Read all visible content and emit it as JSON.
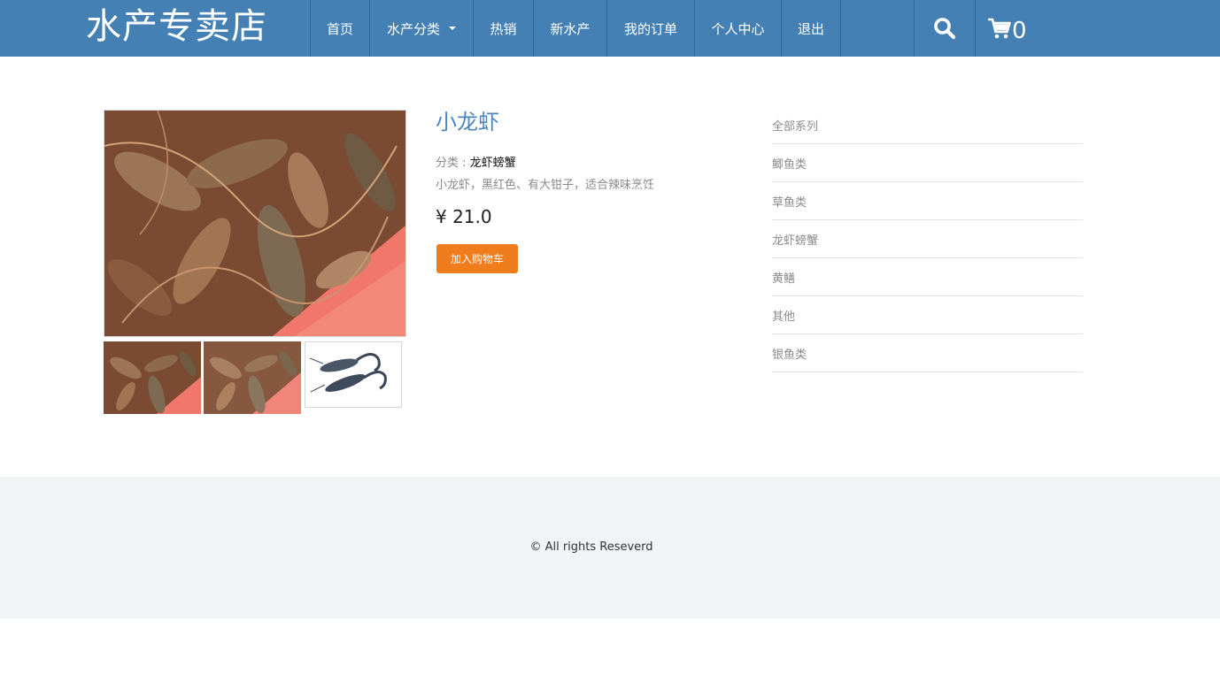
{
  "brand": {
    "name": "水产专卖店"
  },
  "nav": {
    "items": [
      {
        "label": "首页"
      },
      {
        "label": "水产分类"
      },
      {
        "label": "热销"
      },
      {
        "label": "新水产"
      },
      {
        "label": "我的订单"
      },
      {
        "label": "个人中心"
      },
      {
        "label": "退出"
      }
    ],
    "search_icon": "search-icon",
    "cart_icon": "shopping-cart-icon",
    "cart_count": "0"
  },
  "product": {
    "name": "小龙虾",
    "category_label": "分类 : ",
    "category_value": "龙虾螃蟹",
    "description": "小龙虾，黑红色、有大钳子，适合辣味烹饪",
    "price": "¥ 21.0",
    "add_to_cart_label": "加入购物车",
    "images": [
      "crayfish-pile-photo",
      "crayfish-pile-photo",
      "crayfish-white-background-photo"
    ]
  },
  "categories": {
    "items": [
      {
        "label": "全部系列"
      },
      {
        "label": "鲫鱼类"
      },
      {
        "label": "草鱼类"
      },
      {
        "label": "龙虾螃蟹"
      },
      {
        "label": "黄鳝"
      },
      {
        "label": "其他"
      },
      {
        "label": "银鱼类"
      }
    ]
  },
  "footer": {
    "copyright": "© All rights Reseverd"
  },
  "colors": {
    "header": "#4480b4",
    "accent_button": "#f07d1d",
    "title": "#4d86bd",
    "footer_bg": "#f0f4f5"
  }
}
